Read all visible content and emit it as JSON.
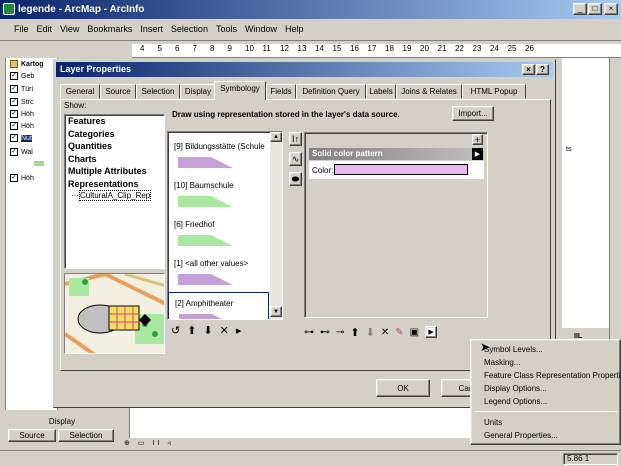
{
  "app": {
    "title": "legende - ArcMap - ArcInfo"
  },
  "menubar": [
    "File",
    "Edit",
    "View",
    "Bookmarks",
    "Insert",
    "Selection",
    "Tools",
    "Window",
    "Help"
  ],
  "ruler": [
    "4",
    "5",
    "6",
    "7",
    "8",
    "9",
    "10",
    "11",
    "12",
    "13",
    "14",
    "15",
    "16",
    "17",
    "18",
    "19",
    "20",
    "21",
    "22",
    "23",
    "24",
    "25",
    "26"
  ],
  "toc": {
    "items": [
      {
        "label": "Kartog",
        "checked": false
      },
      {
        "label": "Geb",
        "checked": true
      },
      {
        "label": "Türi",
        "checked": true
      },
      {
        "label": "Strc",
        "checked": true
      },
      {
        "label": "Höh",
        "checked": true
      },
      {
        "label": "Höh",
        "checked": true
      },
      {
        "label": "Nut",
        "checked": true
      },
      {
        "label": "Wal",
        "checked": true
      },
      {
        "label": "Höh",
        "checked": true
      }
    ],
    "tabs": {
      "header": "Display",
      "source": "Source",
      "selection": "Selection"
    }
  },
  "dialog": {
    "title": "Layer Properties",
    "tabs": [
      "General",
      "Source",
      "Selection",
      "Display",
      "Symbology",
      "Fields",
      "Definition Query",
      "Labels",
      "Joins & Relates",
      "HTML Popup"
    ],
    "active_tab": "Symbology",
    "show_label": "Show:",
    "show_items": [
      "Features",
      "Categories",
      "Quantities",
      "Charts",
      "Multiple Attributes",
      "Representations"
    ],
    "show_sub": "CulturalA_Clip_Rep",
    "description": "Draw using representation stored in the layer's data source.",
    "import_label": "Import...",
    "rules": [
      {
        "label": "[9] Bildungsstätte (Schule",
        "fill": "#c8a0d8"
      },
      {
        "label": "[10] Baumschule",
        "fill": "#a8e8a0"
      },
      {
        "label": "[6] Friedhof",
        "fill": "#a8e8a0"
      },
      {
        "label": "[1] <all other values>",
        "fill": "#c8a0d8"
      },
      {
        "label": "[2] Amphitheater",
        "fill": "#c8a0d8"
      }
    ],
    "pattern": {
      "title": "Solid color pattern",
      "color_label": "Color:",
      "color": "#e8b8f0"
    },
    "ok_label": "OK",
    "cancel_label": "Canc",
    "right_text": "ts",
    "right_text2": "IIL"
  },
  "context_menu": [
    "Symbol Levels...",
    "Masking...",
    "Feature Class Representation Properties...",
    "Display Options...",
    "Legend Options...",
    "Units",
    "General Properties..."
  ],
  "status": {
    "coords": "5.86 1"
  },
  "colors": {
    "titlebar": "#0a246a",
    "face": "#d4d0c8",
    "selection": "#0a246a"
  }
}
